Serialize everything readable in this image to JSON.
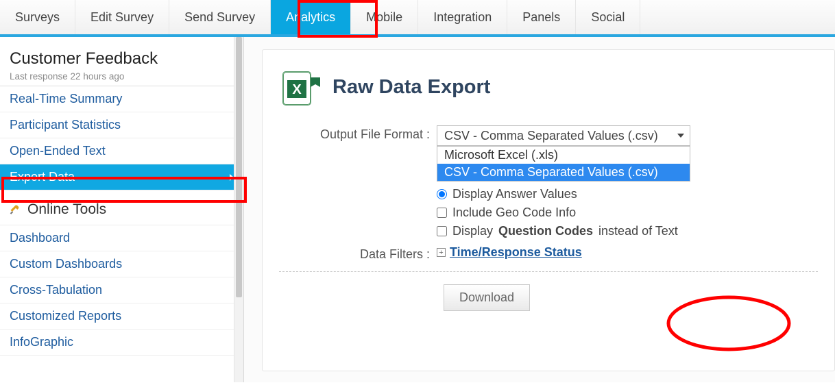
{
  "topnav": {
    "tabs": [
      "Surveys",
      "Edit Survey",
      "Send Survey",
      "Analytics",
      "Mobile",
      "Integration",
      "Panels",
      "Social"
    ],
    "active_index": 3
  },
  "sidebar": {
    "survey_title": "Customer Feedback",
    "last_response": "Last response 22 hours ago",
    "menu1": [
      "Real-Time Summary",
      "Participant Statistics",
      "Open-Ended Text",
      "Export Data"
    ],
    "menu1_active_index": 3,
    "tools_header": "Online Tools",
    "menu2": [
      "Dashboard",
      "Custom Dashboards",
      "Cross-Tabulation",
      "Customized Reports",
      "InfoGraphic"
    ]
  },
  "panel": {
    "title": "Raw Data Export",
    "format_label": "Output File Format :",
    "format_selected": "CSV - Comma Separated Values (.csv)",
    "format_options": [
      "Microsoft Excel (.xls)",
      "CSV - Comma Separated Values (.csv)"
    ],
    "format_sel_index": 1,
    "opt_display_answer_values": "Display Answer Values",
    "opt_include_geo": "Include Geo Code Info",
    "opt_display_qcodes_pre": "Display ",
    "opt_display_qcodes_strong": "Question Codes",
    "opt_display_qcodes_post": " instead of Text",
    "data_filters_label": "Data Filters :",
    "data_filter_link": "Time/Response Status",
    "download_label": "Download"
  }
}
